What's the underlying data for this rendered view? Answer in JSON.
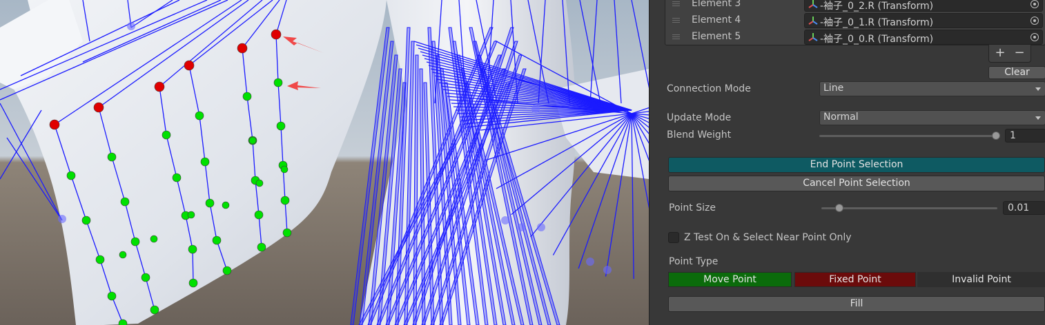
{
  "element_list": [
    {
      "label": "Element 3",
      "value": "-袖子_0_2.R (Transform)"
    },
    {
      "label": "Element 4",
      "value": "-袖子_0_1.R (Transform)"
    },
    {
      "label": "Element 5",
      "value": "-袖子_0_0.R (Transform)"
    }
  ],
  "list_controls": {
    "add": "+",
    "remove": "−"
  },
  "clear_label": "Clear",
  "connection_mode": {
    "label": "Connection Mode",
    "value": "Line"
  },
  "update_mode": {
    "label": "Update Mode",
    "value": "Normal"
  },
  "blend_weight": {
    "label": "Blend Weight",
    "value": "1",
    "level": 1.0
  },
  "end_selection_label": "End Point Selection",
  "cancel_selection_label": "Cancel Point Selection",
  "point_size": {
    "label": "Point Size",
    "value": "0.01",
    "level": 0.1
  },
  "ztest": {
    "label": "Z Test On & Select Near Point Only",
    "checked": false
  },
  "point_type": {
    "label": "Point Type",
    "move": "Move Point",
    "fixed": "Fixed Point",
    "invalid": "Invalid Point"
  },
  "fill_label": "Fill",
  "colors": {
    "end_selection_bg": "#0e5a62",
    "move_point_bg": "#0b6b0b",
    "fixed_point_bg": "#6b0b0b",
    "bone_line": "#1a1aff",
    "moving_point": "#00e000",
    "fixed_point": "#e00000",
    "arrow": "#f04848"
  }
}
